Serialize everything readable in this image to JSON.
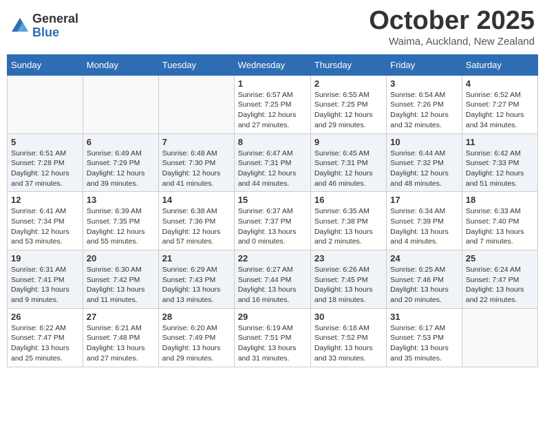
{
  "header": {
    "logo_general": "General",
    "logo_blue": "Blue",
    "month": "October 2025",
    "location": "Waima, Auckland, New Zealand"
  },
  "weekdays": [
    "Sunday",
    "Monday",
    "Tuesday",
    "Wednesday",
    "Thursday",
    "Friday",
    "Saturday"
  ],
  "weeks": [
    [
      {
        "day": "",
        "info": ""
      },
      {
        "day": "",
        "info": ""
      },
      {
        "day": "",
        "info": ""
      },
      {
        "day": "1",
        "info": "Sunrise: 6:57 AM\nSunset: 7:25 PM\nDaylight: 12 hours\nand 27 minutes."
      },
      {
        "day": "2",
        "info": "Sunrise: 6:55 AM\nSunset: 7:25 PM\nDaylight: 12 hours\nand 29 minutes."
      },
      {
        "day": "3",
        "info": "Sunrise: 6:54 AM\nSunset: 7:26 PM\nDaylight: 12 hours\nand 32 minutes."
      },
      {
        "day": "4",
        "info": "Sunrise: 6:52 AM\nSunset: 7:27 PM\nDaylight: 12 hours\nand 34 minutes."
      }
    ],
    [
      {
        "day": "5",
        "info": "Sunrise: 6:51 AM\nSunset: 7:28 PM\nDaylight: 12 hours\nand 37 minutes."
      },
      {
        "day": "6",
        "info": "Sunrise: 6:49 AM\nSunset: 7:29 PM\nDaylight: 12 hours\nand 39 minutes."
      },
      {
        "day": "7",
        "info": "Sunrise: 6:48 AM\nSunset: 7:30 PM\nDaylight: 12 hours\nand 41 minutes."
      },
      {
        "day": "8",
        "info": "Sunrise: 6:47 AM\nSunset: 7:31 PM\nDaylight: 12 hours\nand 44 minutes."
      },
      {
        "day": "9",
        "info": "Sunrise: 6:45 AM\nSunset: 7:31 PM\nDaylight: 12 hours\nand 46 minutes."
      },
      {
        "day": "10",
        "info": "Sunrise: 6:44 AM\nSunset: 7:32 PM\nDaylight: 12 hours\nand 48 minutes."
      },
      {
        "day": "11",
        "info": "Sunrise: 6:42 AM\nSunset: 7:33 PM\nDaylight: 12 hours\nand 51 minutes."
      }
    ],
    [
      {
        "day": "12",
        "info": "Sunrise: 6:41 AM\nSunset: 7:34 PM\nDaylight: 12 hours\nand 53 minutes."
      },
      {
        "day": "13",
        "info": "Sunrise: 6:39 AM\nSunset: 7:35 PM\nDaylight: 12 hours\nand 55 minutes."
      },
      {
        "day": "14",
        "info": "Sunrise: 6:38 AM\nSunset: 7:36 PM\nDaylight: 12 hours\nand 57 minutes."
      },
      {
        "day": "15",
        "info": "Sunrise: 6:37 AM\nSunset: 7:37 PM\nDaylight: 13 hours\nand 0 minutes."
      },
      {
        "day": "16",
        "info": "Sunrise: 6:35 AM\nSunset: 7:38 PM\nDaylight: 13 hours\nand 2 minutes."
      },
      {
        "day": "17",
        "info": "Sunrise: 6:34 AM\nSunset: 7:39 PM\nDaylight: 13 hours\nand 4 minutes."
      },
      {
        "day": "18",
        "info": "Sunrise: 6:33 AM\nSunset: 7:40 PM\nDaylight: 13 hours\nand 7 minutes."
      }
    ],
    [
      {
        "day": "19",
        "info": "Sunrise: 6:31 AM\nSunset: 7:41 PM\nDaylight: 13 hours\nand 9 minutes."
      },
      {
        "day": "20",
        "info": "Sunrise: 6:30 AM\nSunset: 7:42 PM\nDaylight: 13 hours\nand 11 minutes."
      },
      {
        "day": "21",
        "info": "Sunrise: 6:29 AM\nSunset: 7:43 PM\nDaylight: 13 hours\nand 13 minutes."
      },
      {
        "day": "22",
        "info": "Sunrise: 6:27 AM\nSunset: 7:44 PM\nDaylight: 13 hours\nand 16 minutes."
      },
      {
        "day": "23",
        "info": "Sunrise: 6:26 AM\nSunset: 7:45 PM\nDaylight: 13 hours\nand 18 minutes."
      },
      {
        "day": "24",
        "info": "Sunrise: 6:25 AM\nSunset: 7:46 PM\nDaylight: 13 hours\nand 20 minutes."
      },
      {
        "day": "25",
        "info": "Sunrise: 6:24 AM\nSunset: 7:47 PM\nDaylight: 13 hours\nand 22 minutes."
      }
    ],
    [
      {
        "day": "26",
        "info": "Sunrise: 6:22 AM\nSunset: 7:47 PM\nDaylight: 13 hours\nand 25 minutes."
      },
      {
        "day": "27",
        "info": "Sunrise: 6:21 AM\nSunset: 7:48 PM\nDaylight: 13 hours\nand 27 minutes."
      },
      {
        "day": "28",
        "info": "Sunrise: 6:20 AM\nSunset: 7:49 PM\nDaylight: 13 hours\nand 29 minutes."
      },
      {
        "day": "29",
        "info": "Sunrise: 6:19 AM\nSunset: 7:51 PM\nDaylight: 13 hours\nand 31 minutes."
      },
      {
        "day": "30",
        "info": "Sunrise: 6:18 AM\nSunset: 7:52 PM\nDaylight: 13 hours\nand 33 minutes."
      },
      {
        "day": "31",
        "info": "Sunrise: 6:17 AM\nSunset: 7:53 PM\nDaylight: 13 hours\nand 35 minutes."
      },
      {
        "day": "",
        "info": ""
      }
    ]
  ]
}
